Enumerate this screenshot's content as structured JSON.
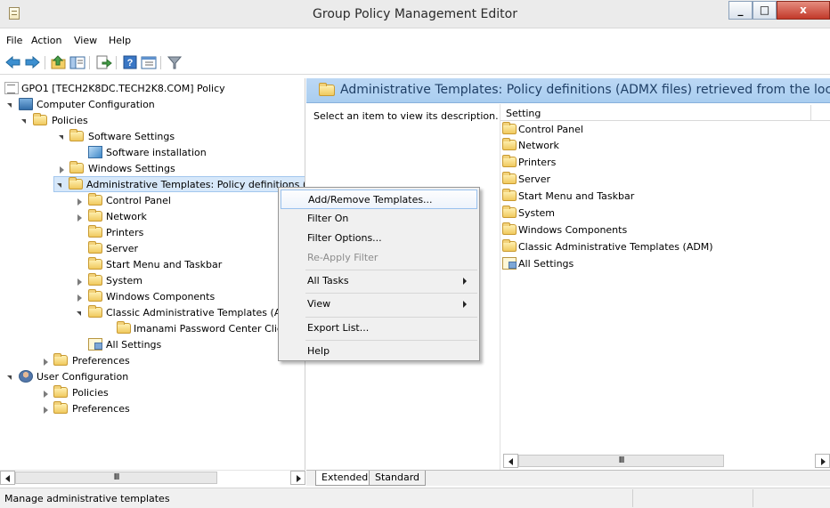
{
  "window": {
    "title": "Group Policy Management Editor",
    "controls": {
      "minimize": "_",
      "maximize": "□",
      "close": "x"
    }
  },
  "menubar": [
    "File",
    "Action",
    "View",
    "Help"
  ],
  "toolbar": {
    "icons": [
      "back-icon",
      "forward-icon",
      "up-folder-icon",
      "show-hide-tree-icon",
      "export-list-icon",
      "help-icon",
      "properties-icon",
      "filter-icon"
    ]
  },
  "tree": {
    "items": [
      {
        "label": "GPO1 [TECH2K8DC.TECH2K8.COM] Policy",
        "icon": "policy-icon"
      },
      {
        "label": "Computer Configuration",
        "icon": "computer-icon"
      },
      {
        "label": "Policies",
        "icon": "folder-icon"
      },
      {
        "label": "Software Settings",
        "icon": "folder-icon"
      },
      {
        "label": "Software installation",
        "icon": "software-installation-icon"
      },
      {
        "label": "Windows Settings",
        "icon": "folder-icon"
      },
      {
        "label": "Administrative Templates: Policy definitions (/",
        "icon": "folder-icon"
      },
      {
        "label": "Control Panel",
        "icon": "folder-icon"
      },
      {
        "label": "Network",
        "icon": "folder-icon"
      },
      {
        "label": "Printers",
        "icon": "folder-icon"
      },
      {
        "label": "Server",
        "icon": "folder-icon"
      },
      {
        "label": "Start Menu and Taskbar",
        "icon": "folder-icon"
      },
      {
        "label": "System",
        "icon": "folder-icon"
      },
      {
        "label": "Windows Components",
        "icon": "folder-icon"
      },
      {
        "label": "Classic Administrative Templates (AI",
        "icon": "folder-icon"
      },
      {
        "label": "Imanami Password Center Client",
        "icon": "folder-icon"
      },
      {
        "label": "All Settings",
        "icon": "all-settings-icon"
      },
      {
        "label": "Preferences",
        "icon": "folder-icon"
      },
      {
        "label": "User Configuration",
        "icon": "user-icon"
      },
      {
        "label": "Policies",
        "icon": "folder-icon"
      },
      {
        "label": "Preferences",
        "icon": "folder-icon"
      }
    ],
    "scroll_glyph": "III"
  },
  "right_pane": {
    "header": "Administrative Templates: Policy definitions (ADMX files) retrieved from the local c",
    "description": "Select an item to view its description.",
    "column_header": "Setting",
    "items": [
      {
        "label": "Control Panel",
        "icon": "folder-icon"
      },
      {
        "label": "Network",
        "icon": "folder-icon"
      },
      {
        "label": "Printers",
        "icon": "folder-icon"
      },
      {
        "label": "Server",
        "icon": "folder-icon"
      },
      {
        "label": "Start Menu and Taskbar",
        "icon": "folder-icon"
      },
      {
        "label": "System",
        "icon": "folder-icon"
      },
      {
        "label": "Windows Components",
        "icon": "folder-icon"
      },
      {
        "label": "Classic Administrative Templates (ADM)",
        "icon": "folder-icon"
      },
      {
        "label": "All Settings",
        "icon": "all-settings-icon"
      }
    ],
    "scroll_glyph": "III"
  },
  "tabs": [
    "Extended",
    "Standard"
  ],
  "context_menu": {
    "items": [
      {
        "label": "Add/Remove Templates..."
      },
      {
        "label": "Filter On"
      },
      {
        "label": "Filter Options..."
      },
      {
        "label": "Re-Apply Filter"
      },
      {
        "label": "All Tasks"
      },
      {
        "label": "View"
      },
      {
        "label": "Export List..."
      },
      {
        "label": "Help"
      }
    ]
  },
  "status": {
    "text": "Manage administrative templates"
  }
}
